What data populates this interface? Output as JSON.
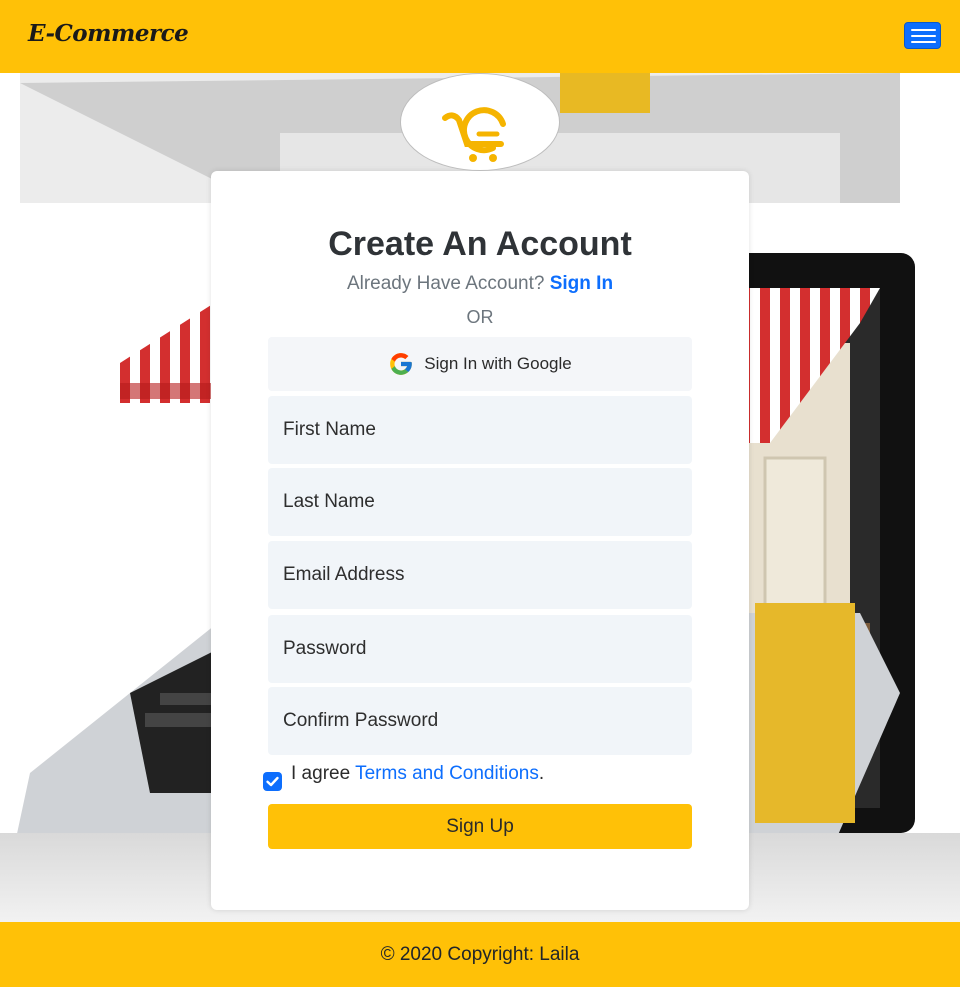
{
  "navbar": {
    "brand": "E-Commerce",
    "brand_color": "#ffc107",
    "menu_icon": "hamburger-menu-icon"
  },
  "logo": {
    "icon": "shopping-cart-logo-icon",
    "color": "#ffc107"
  },
  "form": {
    "title": "Create An Account",
    "already_text": "Already Have Account?",
    "sign_in_link": "Sign In",
    "or_text": "OR",
    "google_button": "Sign In with Google",
    "google_icon": "google-icon",
    "fields": {
      "first_name": {
        "placeholder": "First Name",
        "value": ""
      },
      "last_name": {
        "placeholder": "Last Name",
        "value": ""
      },
      "email": {
        "placeholder": "Email Address",
        "value": ""
      },
      "password": {
        "placeholder": "Password",
        "value": ""
      },
      "confirm_password": {
        "placeholder": "Confirm Password",
        "value": ""
      }
    },
    "agree_prefix": "I agree ",
    "terms_link": "Terms and Conditions",
    "agree_suffix": ".",
    "agree_checked": true,
    "submit": "Sign Up"
  },
  "footer": {
    "text": "© 2020 Copyright: Laila"
  },
  "colors": {
    "accent": "#ffc107",
    "link": "#0d6efd",
    "field_bg": "#f1f5f9"
  }
}
